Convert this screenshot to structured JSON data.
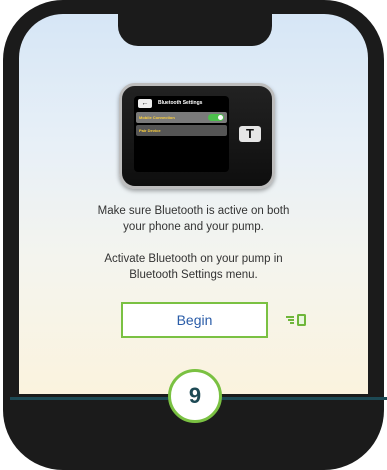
{
  "pump": {
    "back_glyph": "←",
    "screen_title": "Bluetooth Settings",
    "rows": [
      "Mobile Connection",
      "Pair Device"
    ],
    "mobile_connection_on": true,
    "logo": "T"
  },
  "instructions": {
    "para1": [
      "Make sure Bluetooth is active on both",
      "your phone and your pump."
    ],
    "para2": [
      "Activate Bluetooth on your pump in",
      "Bluetooth Settings menu."
    ]
  },
  "begin_label": "Begin",
  "step_number": "9",
  "icons": {
    "pump_icon": "pump-connect-icon"
  },
  "colors": {
    "accent_green": "#7ac142",
    "button_text": "#2a5ca8",
    "teal": "#1d4954"
  }
}
